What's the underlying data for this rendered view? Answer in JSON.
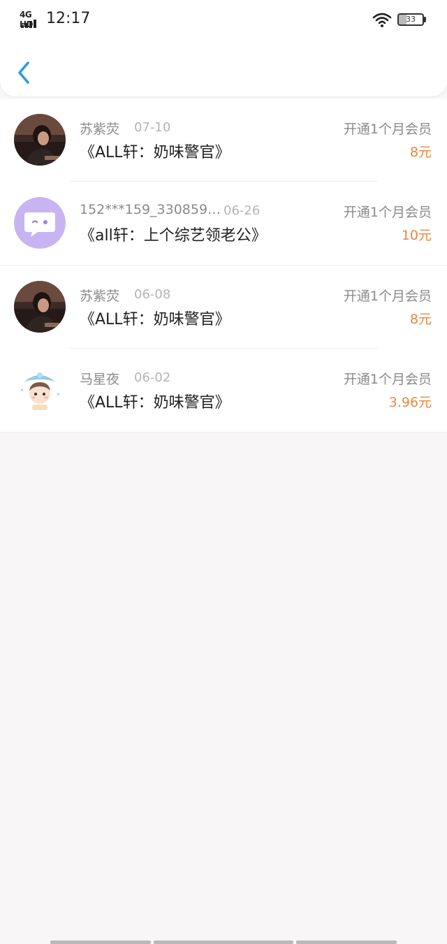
{
  "status_bar": {
    "network": "4G HD",
    "time": "12:17",
    "battery": "33",
    "icons": [
      "signal-icon",
      "wifi-icon",
      "battery-icon"
    ]
  },
  "header": {
    "back_icon": "chevron-left-icon"
  },
  "colors": {
    "accent": "#2b9be8",
    "price": "#e8873f",
    "muted_text": "#8a8a8a",
    "date_text": "#b4b4b4",
    "title_text": "#1f1f1f",
    "background": "#f8f6f7"
  },
  "records": [
    {
      "username": "苏紫荧",
      "date": "07-10",
      "title": "《ALL轩：奶味警官》",
      "action": "开通1个月会员",
      "price": "8元",
      "avatar": "photo-avatar"
    },
    {
      "username": "152***159_330859…",
      "date": "06-26",
      "title": "《all轩：上个综艺领老公》",
      "action": "开通1个月会员",
      "price": "10元",
      "avatar": "chat-bubble-avatar"
    },
    {
      "username": "苏紫荧",
      "date": "06-08",
      "title": "《ALL轩：奶味警官》",
      "action": "开通1个月会员",
      "price": "8元",
      "avatar": "photo-avatar"
    },
    {
      "username": "马星夜",
      "date": "06-02",
      "title": "《ALL轩：奶味警官》",
      "action": "开通1个月会员",
      "price": "3.96元",
      "avatar": "cartoon-avatar"
    }
  ]
}
